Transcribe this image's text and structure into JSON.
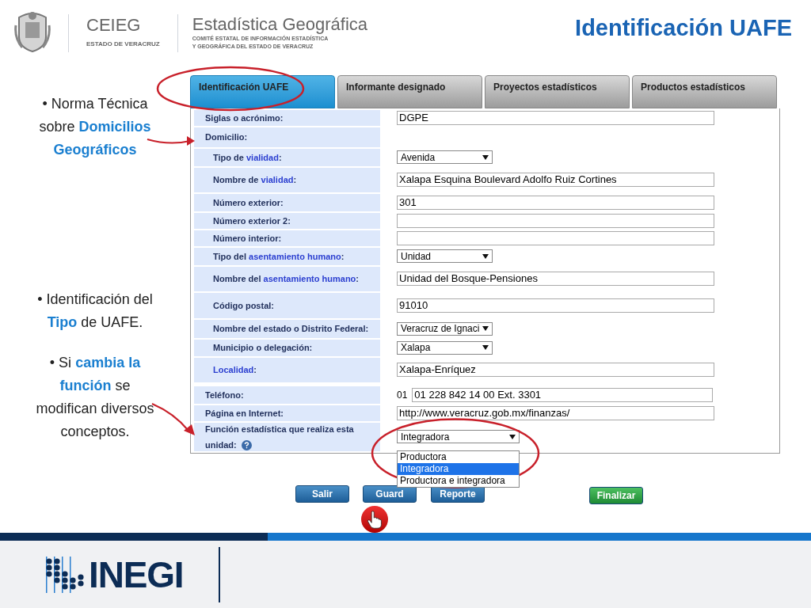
{
  "header": {
    "org": "CEIEG",
    "org_sub": "ESTADO DE VERACRUZ",
    "brand": "Estadística Geográfica",
    "brand_sub": [
      "COMITÉ ESTATAL DE INFORMACIÓN ESTADÍSTICA",
      "Y GEOGRÁFICA DEL ESTADO DE VERACRUZ"
    ],
    "title": "Identificación UAFE"
  },
  "bullets": [
    "• Norma Técnica sobre **Domicilios Geográficos**",
    "• Identificación del **Tipo** de UAFE.",
    "• Si **cambia la función** se modifican diversos conceptos."
  ],
  "tabs": [
    {
      "label": "Identificación UAFE",
      "selected": true
    },
    {
      "label": "Informante designado",
      "selected": false
    },
    {
      "label": "Proyectos estadísticos",
      "selected": false
    },
    {
      "label": "Productos estadísticos",
      "selected": false
    }
  ],
  "form": [
    {
      "label": "Siglas o acrónimo:",
      "kind": "text",
      "value": "DGPE"
    },
    {
      "label": "Domicilio:",
      "kind": "none",
      "children": [
        {
          "label": "Tipo de *vialidad*:",
          "kind": "select",
          "value": "Avenida"
        },
        {
          "label": "Nombre de *vialidad*:",
          "kind": "text",
          "value": "Xalapa Esquina Boulevard Adolfo Ruiz Cortines"
        },
        {
          "label": "Número exterior:",
          "kind": "text",
          "value": "301"
        },
        {
          "label": "Número exterior 2:",
          "kind": "text"
        },
        {
          "label": "Número interior:",
          "kind": "text"
        },
        {
          "label": "Tipo del *asentamiento humano*:",
          "kind": "select",
          "value": "Unidad"
        },
        {
          "label": "Nombre del *asentamiento humano*:",
          "kind": "text",
          "value": "Unidad del Bosque-Pensiones"
        },
        {
          "label": "Código postal:",
          "kind": "text",
          "value": "91010"
        },
        {
          "label": "Nombre del estado o Distrito Federal:",
          "kind": "select",
          "value": "Veracruz de Ignaci"
        },
        {
          "label": "Municipio o delegación:",
          "kind": "select",
          "value": "Xalapa"
        },
        {
          "label": "*Localidad*:",
          "kind": "text",
          "value": "Xalapa-Enríquez"
        }
      ]
    },
    {
      "label": "Teléfono:",
      "kind": "phone",
      "prefix": "01",
      "value": "01 228 842 14 00 Ext. 3301"
    },
    {
      "label": "Página en Internet:",
      "kind": "text",
      "value": "http://www.veracruz.gob.mx/finanzas/"
    },
    {
      "label": "Función estadística que realiza esta unidad:",
      "kind": "dropdown",
      "help": true,
      "value": "Integradora",
      "expanded": true,
      "options": [
        {
          "label": "Productora",
          "selected": false
        },
        {
          "label": "Integradora",
          "selected": true
        },
        {
          "label": "Productora e integradora",
          "selected": false
        }
      ]
    }
  ],
  "buttons": [
    {
      "label": "Salir",
      "kind": "blue"
    },
    {
      "label": "Guard",
      "kind": "blue"
    },
    {
      "label": "Reporte",
      "kind": "blue"
    },
    {
      "label": "Finalizar",
      "kind": "green"
    }
  ],
  "footer": {
    "logo": "INEGI"
  }
}
